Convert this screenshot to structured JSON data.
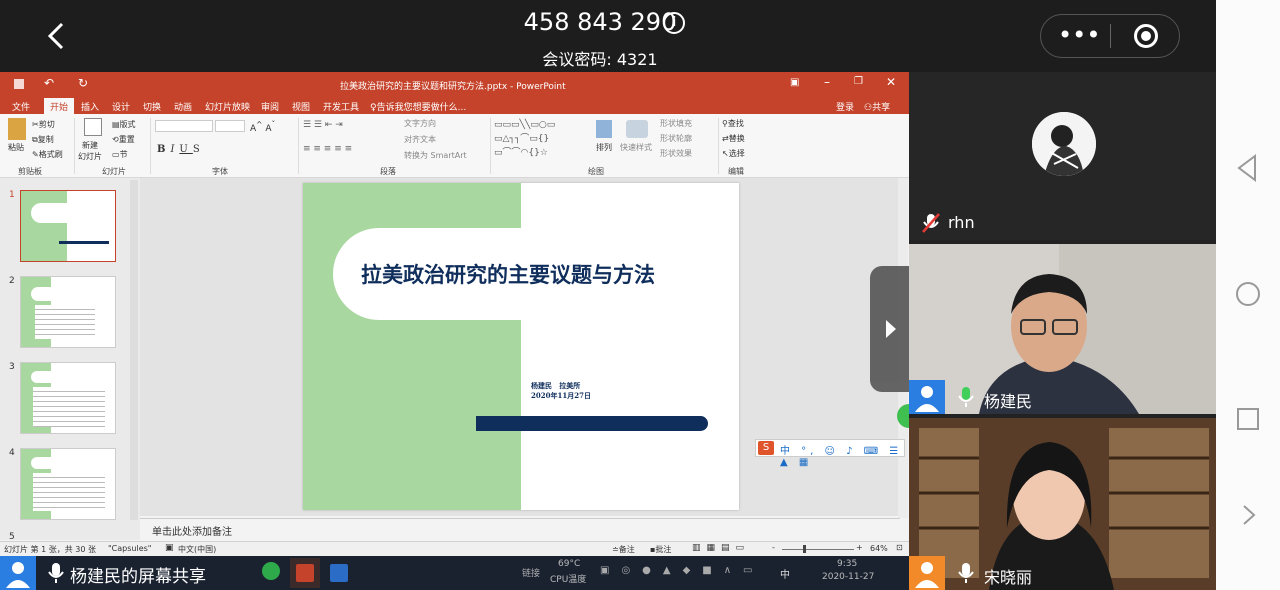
{
  "meeting": {
    "id": "458 843 290",
    "password": "会议密码: 4321"
  },
  "ppt": {
    "window_title": "拉美政治研究的主要议题和研究方法.pptx - PowerPoint",
    "menu": [
      "文件",
      "开始",
      "插入",
      "设计",
      "切换",
      "动画",
      "幻灯片放映",
      "审阅",
      "视图",
      "开发工具"
    ],
    "tell_me": "告诉我您想要做什么...",
    "login": "登录",
    "share": "共享",
    "ribbon": {
      "clipboard": {
        "paste": "粘贴",
        "cut": "剪切",
        "copy": "复制",
        "format_painter": "格式刷",
        "label": "剪贴板"
      },
      "slides": {
        "new": "新建\n幻灯片",
        "layout": "版式",
        "reset": "重置",
        "section": "节",
        "label": "幻灯片"
      },
      "font": {
        "label": "字体"
      },
      "paragraph": {
        "text_direction": "文字方向",
        "align_text": "对齐文本",
        "smartart": "转换为 SmartArt",
        "label": "段落"
      },
      "drawing": {
        "arrange": "排列",
        "quick_styles": "快速样式",
        "fill": "形状填充",
        "outline": "形状轮廓",
        "effects": "形状效果",
        "label": "绘图"
      },
      "editing": {
        "find": "查找",
        "replace": "替换",
        "select": "选择",
        "label": "编辑"
      }
    },
    "slide_numbers": [
      "1",
      "2",
      "3",
      "4",
      "5"
    ],
    "slide": {
      "title": "拉美政治研究的主要议题与方法",
      "author": "杨建民   拉美所",
      "date": "2020年11月27日"
    },
    "notes_placeholder": "单击此处添加备注",
    "status": {
      "slide_info": "幻灯片 第 1 张，共 30 张",
      "theme": "\"Capsules\"",
      "language": "中文(中国)",
      "notes": "备注",
      "comments": "批注",
      "zoom": "64%"
    },
    "taskbar": {
      "temp": "69°C",
      "cpu": "CPU温度",
      "time": "9:35",
      "date": "2020-11-27"
    }
  },
  "screen_share_label": "杨建民的屏幕共享",
  "participants": [
    {
      "name": "rhn",
      "muted": true
    },
    {
      "name": "杨建民",
      "muted": false
    },
    {
      "name": "宋晓丽",
      "muted": false
    }
  ],
  "colors": {
    "ppt_red": "#c5432b",
    "slide_green": "#a8d8a0",
    "slide_navy": "#0f2e5c"
  }
}
